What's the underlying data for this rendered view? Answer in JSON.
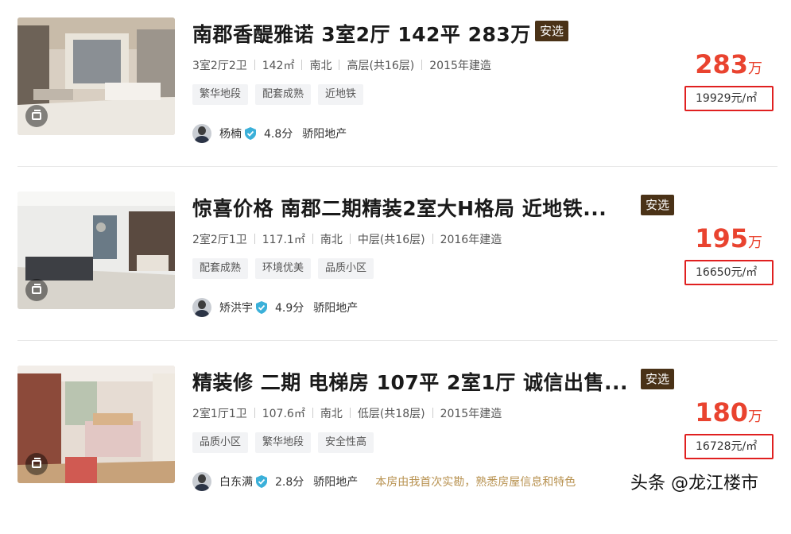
{
  "colors": {
    "accent_price": "#e9432f",
    "badge_bg": "#4a3217",
    "unit_price_border": "#e02020",
    "note_text": "#b89250"
  },
  "listings": [
    {
      "title": "南郡香醍雅诺 3室2厅 142平 283万",
      "badge": "安选",
      "specs": [
        "3室2厅2卫",
        "142㎡",
        "南北",
        "高层(共16层)",
        "2015年建造"
      ],
      "tags": [
        "繁华地段",
        "配套成熟",
        "近地铁"
      ],
      "agent_name": "杨楠",
      "agent_score": "4.8分",
      "agent_company": "骄阳地产",
      "agent_note": "",
      "price_num": "283",
      "price_unit": "万",
      "unit_price": "19929元/㎡"
    },
    {
      "title": "惊喜价格 南郡二期精装2室大H格局 近地铁...",
      "badge": "安选",
      "specs": [
        "2室2厅1卫",
        "117.1㎡",
        "南北",
        "中层(共16层)",
        "2016年建造"
      ],
      "tags": [
        "配套成熟",
        "环境优美",
        "品质小区"
      ],
      "agent_name": "矫洪宇",
      "agent_score": "4.9分",
      "agent_company": "骄阳地产",
      "agent_note": "",
      "price_num": "195",
      "price_unit": "万",
      "unit_price": "16650元/㎡"
    },
    {
      "title": "精装修 二期 电梯房 107平 2室1厅 诚信出售...",
      "badge": "安选",
      "specs": [
        "2室1厅1卫",
        "107.6㎡",
        "南北",
        "低层(共18层)",
        "2015年建造"
      ],
      "tags": [
        "品质小区",
        "繁华地段",
        "安全性高"
      ],
      "agent_name": "白东满",
      "agent_score": "2.8分",
      "agent_company": "骄阳地产",
      "agent_note": "本房由我首次实勘，熟悉房屋信息和特色",
      "price_num": "180",
      "price_unit": "万",
      "unit_price": "16728元/㎡"
    }
  ],
  "watermark": "头条 @龙江楼市"
}
